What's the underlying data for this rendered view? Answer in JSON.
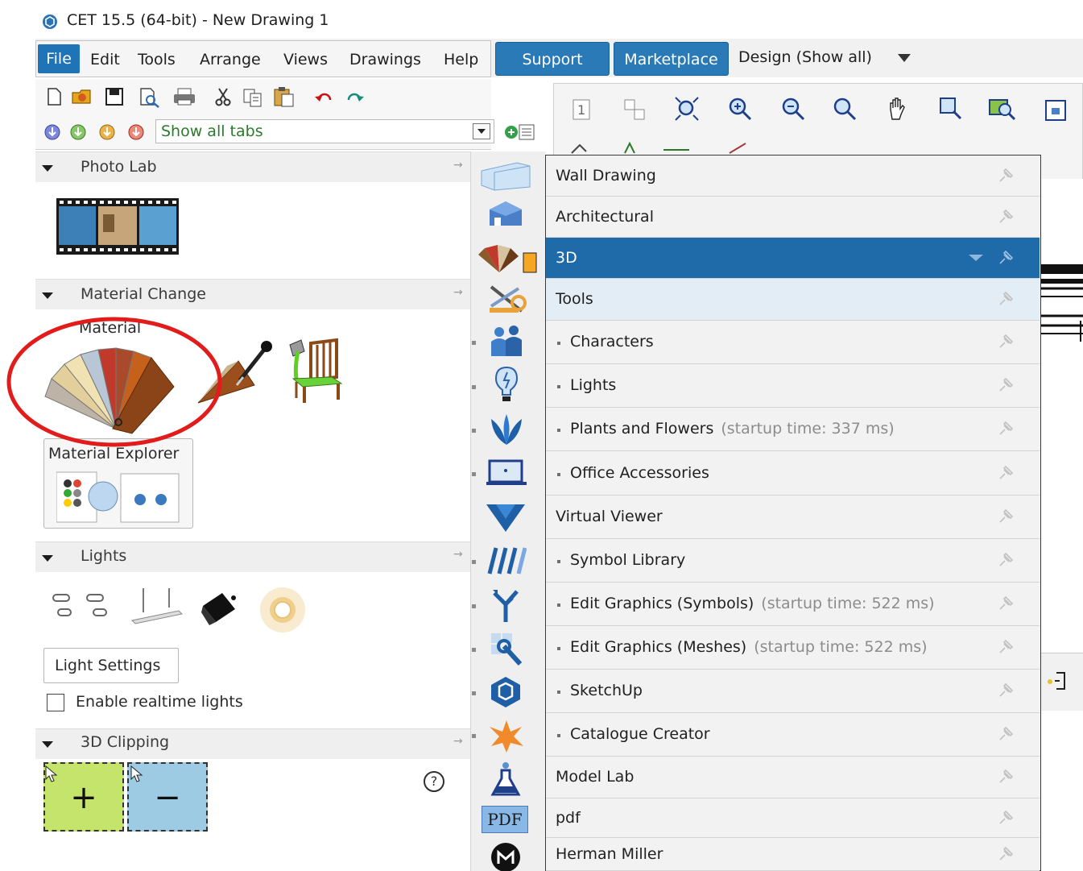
{
  "window": {
    "title": "CET 15.5 (64-bit) - New Drawing 1"
  },
  "menu": {
    "items": [
      "File",
      "Edit",
      "Tools",
      "Arrange",
      "Views",
      "Drawings",
      "Help"
    ],
    "support": "Support",
    "marketplace": "Marketplace",
    "design": "Design (Show all)"
  },
  "toolbar": {
    "tabs_filter": "Show all tabs"
  },
  "panels": {
    "photo_lab": {
      "title": "Photo Lab"
    },
    "material_change": {
      "title": "Material Change",
      "material_label": "Material",
      "explorer_label": "Material Explorer"
    },
    "lights": {
      "title": "Lights",
      "settings_button": "Light Settings",
      "realtime_checkbox": "Enable realtime lights"
    },
    "clipping": {
      "title": "3D Clipping",
      "plus": "+",
      "minus": "−",
      "help": "?"
    }
  },
  "extensions": {
    "items": [
      {
        "label": "Wall Drawing",
        "indent": false
      },
      {
        "label": "Architectural",
        "indent": false
      },
      {
        "label": "3D",
        "indent": false,
        "selected": true
      },
      {
        "label": "Tools",
        "indent": false,
        "highlighted": true
      },
      {
        "label": "Characters",
        "indent": true
      },
      {
        "label": "Lights",
        "indent": true
      },
      {
        "label": "Plants and Flowers",
        "indent": true,
        "startup": "(startup time: 337 ms)"
      },
      {
        "label": "Office Accessories",
        "indent": true
      },
      {
        "label": "Virtual Viewer",
        "indent": false
      },
      {
        "label": "Symbol Library",
        "indent": true
      },
      {
        "label": "Edit Graphics (Symbols)",
        "indent": true,
        "startup": "(startup time: 522 ms)"
      },
      {
        "label": "Edit Graphics (Meshes)",
        "indent": true,
        "startup": "(startup time: 522 ms)"
      },
      {
        "label": "SketchUp",
        "indent": true
      },
      {
        "label": "Catalogue Creator",
        "indent": true
      },
      {
        "label": "Model Lab",
        "indent": false
      },
      {
        "label": "pdf",
        "indent": false
      },
      {
        "label": "Herman Miller",
        "indent": false
      }
    ]
  },
  "sidebar_icons": [
    "pdf-label"
  ],
  "sidebar_pdf": "PDF",
  "colors": {
    "accent": "#1f6aa8",
    "annotation": "#e21b1b",
    "clip_plus": "#c5e46b",
    "clip_minus": "#9ccbe3"
  }
}
